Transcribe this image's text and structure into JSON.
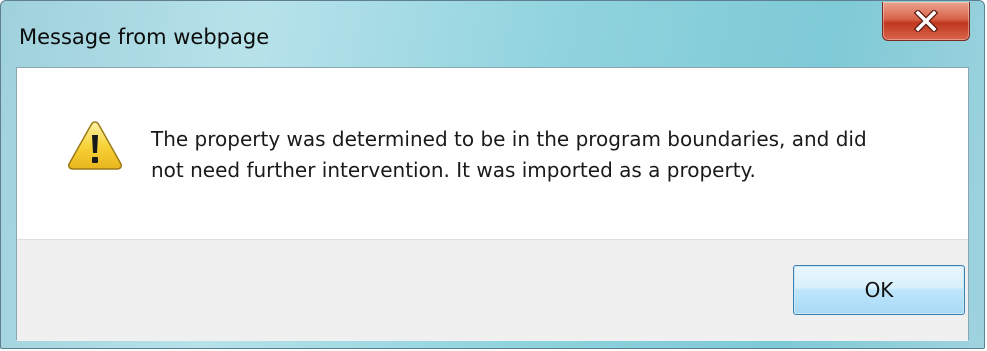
{
  "window": {
    "title": "Message from webpage",
    "close_icon": "close-x-icon"
  },
  "message": {
    "icon": "warning-icon",
    "line1": "The property was determined to be in the program boundaries, and did",
    "line2": "not need further intervention. It was imported as a property."
  },
  "buttons": {
    "ok_label": "OK"
  },
  "colors": {
    "titlebar": "#9fd1dc",
    "close_button": "#c9452b",
    "ok_button_border": "#3c7fb1",
    "footer_background": "#f0f0f0",
    "warning_yellow": "#f7d23c"
  }
}
